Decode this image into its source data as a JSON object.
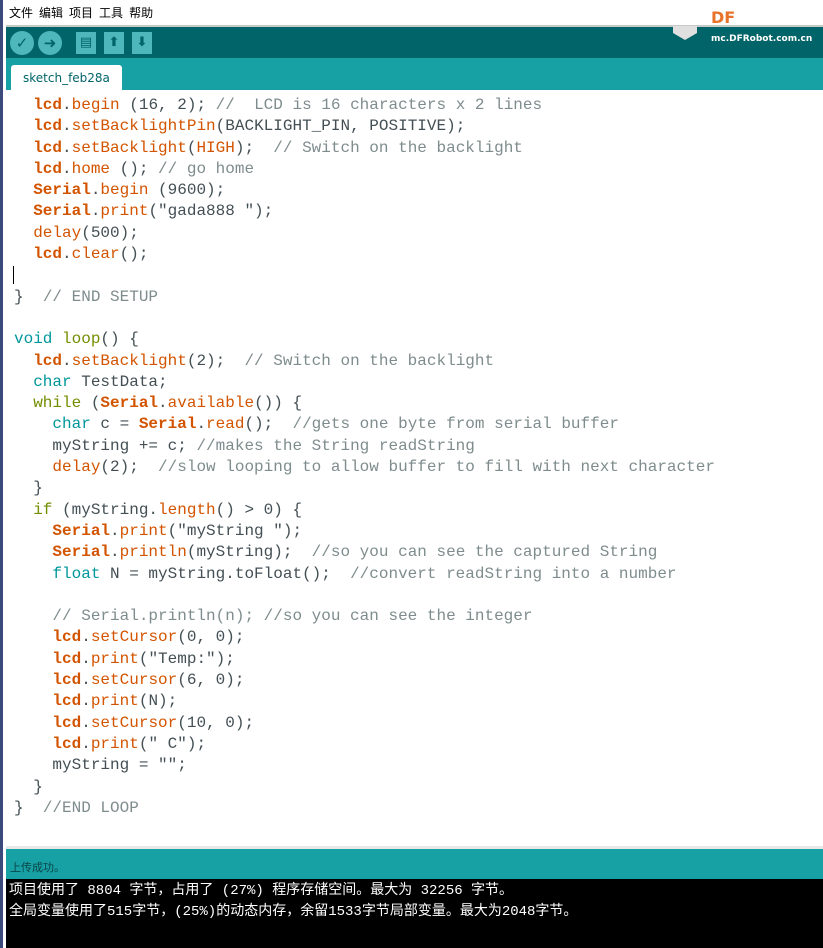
{
  "menu": [
    "文件",
    "编辑",
    "项目",
    "工具",
    "帮助"
  ],
  "toolbar": {
    "verify": "✓",
    "upload": "➜",
    "new": "▤",
    "open": "⬆",
    "save": "⬇"
  },
  "logo": {
    "brand": "DF",
    "url": "mc.DFRobot.com.cn"
  },
  "tab": {
    "label": "sketch_feb28a"
  },
  "colors": {
    "toolbar": "#006468",
    "accent": "#17a1a5",
    "function": "#d35400",
    "type": "#00979c",
    "control": "#728e00",
    "comment": "#7f8c8d"
  },
  "code": [
    [
      [
        "p",
        "  "
      ],
      [
        "kb",
        "lcd"
      ],
      [
        "p",
        "."
      ],
      [
        "k",
        "begin"
      ],
      [
        "p",
        " (16, 2); "
      ],
      [
        "cm",
        "//  LCD is 16 characters x 2 lines"
      ]
    ],
    [
      [
        "p",
        "  "
      ],
      [
        "kb",
        "lcd"
      ],
      [
        "p",
        "."
      ],
      [
        "k",
        "setBacklightPin"
      ],
      [
        "p",
        "(BACKLIGHT_PIN, POSITIVE);"
      ]
    ],
    [
      [
        "p",
        "  "
      ],
      [
        "kb",
        "lcd"
      ],
      [
        "p",
        "."
      ],
      [
        "k",
        "setBacklight"
      ],
      [
        "p",
        "("
      ],
      [
        "k",
        "HIGH"
      ],
      [
        "p",
        ");  "
      ],
      [
        "cm",
        "// Switch on the backlight"
      ]
    ],
    [
      [
        "p",
        "  "
      ],
      [
        "kb",
        "lcd"
      ],
      [
        "p",
        "."
      ],
      [
        "k",
        "home"
      ],
      [
        "p",
        " (); "
      ],
      [
        "cm",
        "// go home"
      ]
    ],
    [
      [
        "p",
        "  "
      ],
      [
        "kb",
        "Serial"
      ],
      [
        "p",
        "."
      ],
      [
        "k",
        "begin"
      ],
      [
        "p",
        " (9600);"
      ]
    ],
    [
      [
        "p",
        "  "
      ],
      [
        "kb",
        "Serial"
      ],
      [
        "p",
        "."
      ],
      [
        "k",
        "print"
      ],
      [
        "p",
        "(\"gada888 \");"
      ]
    ],
    [
      [
        "p",
        "  "
      ],
      [
        "k",
        "delay"
      ],
      [
        "p",
        "(500);"
      ]
    ],
    [
      [
        "p",
        "  "
      ],
      [
        "kb",
        "lcd"
      ],
      [
        "p",
        "."
      ],
      [
        "k",
        "clear"
      ],
      [
        "p",
        "();"
      ]
    ],
    [
      [
        "p",
        ""
      ]
    ],
    [
      [
        "p",
        "}  "
      ],
      [
        "cm",
        "// END SETUP"
      ]
    ],
    [
      [
        "p",
        ""
      ]
    ],
    [
      [
        "t",
        "void"
      ],
      [
        "p",
        " "
      ],
      [
        "c",
        "loop"
      ],
      [
        "p",
        "() {"
      ]
    ],
    [
      [
        "p",
        "  "
      ],
      [
        "kb",
        "lcd"
      ],
      [
        "p",
        "."
      ],
      [
        "k",
        "setBacklight"
      ],
      [
        "p",
        "(2);  "
      ],
      [
        "cm",
        "// Switch on the backlight"
      ]
    ],
    [
      [
        "p",
        "  "
      ],
      [
        "t",
        "char"
      ],
      [
        "p",
        " TestData;"
      ]
    ],
    [
      [
        "p",
        "  "
      ],
      [
        "c",
        "while"
      ],
      [
        "p",
        " ("
      ],
      [
        "kb",
        "Serial"
      ],
      [
        "p",
        "."
      ],
      [
        "k",
        "available"
      ],
      [
        "p",
        "()) {"
      ]
    ],
    [
      [
        "p",
        "    "
      ],
      [
        "t",
        "char"
      ],
      [
        "p",
        " c = "
      ],
      [
        "kb",
        "Serial"
      ],
      [
        "p",
        "."
      ],
      [
        "k",
        "read"
      ],
      [
        "p",
        "();  "
      ],
      [
        "cm",
        "//gets one byte from serial buffer"
      ]
    ],
    [
      [
        "p",
        "    myString += c; "
      ],
      [
        "cm",
        "//makes the String readString"
      ]
    ],
    [
      [
        "p",
        "    "
      ],
      [
        "k",
        "delay"
      ],
      [
        "p",
        "(2);  "
      ],
      [
        "cm",
        "//slow looping to allow buffer to fill with next character"
      ]
    ],
    [
      [
        "p",
        "  }"
      ]
    ],
    [
      [
        "p",
        "  "
      ],
      [
        "c",
        "if"
      ],
      [
        "p",
        " (myString."
      ],
      [
        "k",
        "length"
      ],
      [
        "p",
        "() > 0) {"
      ]
    ],
    [
      [
        "p",
        "    "
      ],
      [
        "kb",
        "Serial"
      ],
      [
        "p",
        "."
      ],
      [
        "k",
        "print"
      ],
      [
        "p",
        "(\"myString \");"
      ]
    ],
    [
      [
        "p",
        "    "
      ],
      [
        "kb",
        "Serial"
      ],
      [
        "p",
        "."
      ],
      [
        "k",
        "println"
      ],
      [
        "p",
        "(myString);  "
      ],
      [
        "cm",
        "//so you can see the captured String"
      ]
    ],
    [
      [
        "p",
        "    "
      ],
      [
        "t",
        "float"
      ],
      [
        "p",
        " N = myString.toFloat();  "
      ],
      [
        "cm",
        "//convert readString into a number"
      ]
    ],
    [
      [
        "p",
        ""
      ]
    ],
    [
      [
        "p",
        "    "
      ],
      [
        "cm",
        "// Serial.println(n); //so you can see the integer"
      ]
    ],
    [
      [
        "p",
        "    "
      ],
      [
        "kb",
        "lcd"
      ],
      [
        "p",
        "."
      ],
      [
        "k",
        "setCursor"
      ],
      [
        "p",
        "(0, 0);"
      ]
    ],
    [
      [
        "p",
        "    "
      ],
      [
        "kb",
        "lcd"
      ],
      [
        "p",
        "."
      ],
      [
        "k",
        "print"
      ],
      [
        "p",
        "(\"Temp:\");"
      ]
    ],
    [
      [
        "p",
        "    "
      ],
      [
        "kb",
        "lcd"
      ],
      [
        "p",
        "."
      ],
      [
        "k",
        "setCursor"
      ],
      [
        "p",
        "(6, 0);"
      ]
    ],
    [
      [
        "p",
        "    "
      ],
      [
        "kb",
        "lcd"
      ],
      [
        "p",
        "."
      ],
      [
        "k",
        "print"
      ],
      [
        "p",
        "(N);"
      ]
    ],
    [
      [
        "p",
        "    "
      ],
      [
        "kb",
        "lcd"
      ],
      [
        "p",
        "."
      ],
      [
        "k",
        "setCursor"
      ],
      [
        "p",
        "(10, 0);"
      ]
    ],
    [
      [
        "p",
        "    "
      ],
      [
        "kb",
        "lcd"
      ],
      [
        "p",
        "."
      ],
      [
        "k",
        "print"
      ],
      [
        "p",
        "(\" C\");"
      ]
    ],
    [
      [
        "p",
        "    myString = \"\";"
      ]
    ],
    [
      [
        "p",
        "  }"
      ]
    ],
    [
      [
        "p",
        "}  "
      ],
      [
        "cm",
        "//END LOOP"
      ]
    ]
  ],
  "status": {
    "message": "上传成功。"
  },
  "console": [
    "项目使用了 8804 字节，占用了 (27%) 程序存储空间。最大为 32256 字节。",
    "全局变量使用了515字节，(25%)的动态内存，余留1533字节局部变量。最大为2048字节。"
  ]
}
